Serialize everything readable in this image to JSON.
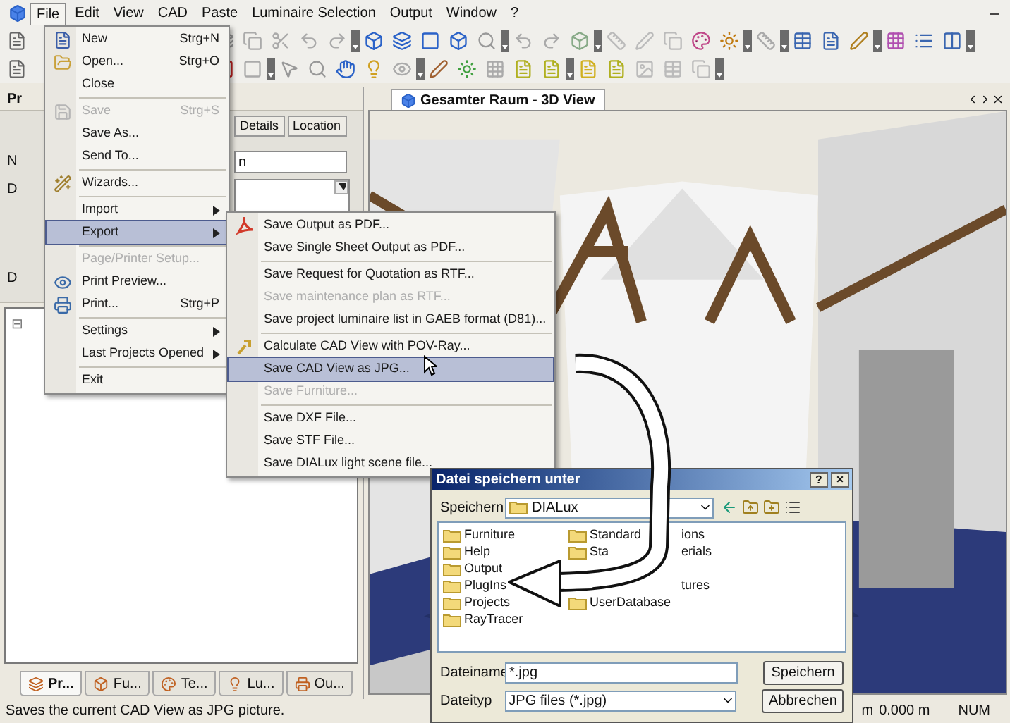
{
  "menubar": {
    "items": [
      {
        "label": "File",
        "selected": true
      },
      {
        "label": "Edit",
        "selected": false
      },
      {
        "label": "View",
        "selected": false
      },
      {
        "label": "CAD",
        "selected": false
      },
      {
        "label": "Paste",
        "selected": false
      },
      {
        "label": "Luminaire Selection",
        "selected": false
      },
      {
        "label": "Output",
        "selected": false
      },
      {
        "label": "Window",
        "selected": false
      },
      {
        "label": "?",
        "selected": false
      }
    ]
  },
  "file_menu": {
    "items": [
      {
        "kind": "item",
        "label": "New",
        "shortcut": "Strg+N",
        "submenu": false,
        "disabled": false,
        "selected": false
      },
      {
        "kind": "item",
        "label": "Open...",
        "shortcut": "Strg+O",
        "submenu": false,
        "disabled": false,
        "selected": false
      },
      {
        "kind": "item",
        "label": "Close",
        "submenu": false,
        "disabled": false,
        "selected": false
      },
      {
        "kind": "separator"
      },
      {
        "kind": "item",
        "label": "Save",
        "shortcut": "Strg+S",
        "submenu": false,
        "disabled": true,
        "selected": false
      },
      {
        "kind": "item",
        "label": "Save As...",
        "submenu": false,
        "disabled": false,
        "selected": false
      },
      {
        "kind": "item",
        "label": "Send To...",
        "submenu": false,
        "disabled": false,
        "selected": false
      },
      {
        "kind": "separator"
      },
      {
        "kind": "item",
        "label": "Wizards...",
        "submenu": false,
        "disabled": false,
        "selected": false
      },
      {
        "kind": "separator"
      },
      {
        "kind": "item",
        "label": "Import",
        "submenu": true,
        "disabled": false,
        "selected": false
      },
      {
        "kind": "item",
        "label": "Export",
        "submenu": true,
        "disabled": false,
        "selected": true
      },
      {
        "kind": "separator"
      },
      {
        "kind": "item",
        "label": "Page/Printer Setup...",
        "submenu": false,
        "disabled": true,
        "selected": false
      },
      {
        "kind": "item",
        "label": "Print Preview...",
        "submenu": false,
        "disabled": false,
        "selected": false
      },
      {
        "kind": "item",
        "label": "Print...",
        "shortcut": "Strg+P",
        "submenu": false,
        "disabled": false,
        "selected": false
      },
      {
        "kind": "separator"
      },
      {
        "kind": "item",
        "label": "Settings",
        "submenu": true,
        "disabled": false,
        "selected": false
      },
      {
        "kind": "item",
        "label": "Last Projects Opened",
        "submenu": true,
        "disabled": false,
        "selected": false
      },
      {
        "kind": "separator"
      },
      {
        "kind": "item",
        "label": "Exit",
        "submenu": false,
        "disabled": false,
        "selected": false
      }
    ]
  },
  "export_menu": {
    "items": [
      {
        "kind": "item",
        "label": "Save Output as PDF...",
        "submenu": false,
        "disabled": false,
        "selected": false
      },
      {
        "kind": "item",
        "label": "Save Single Sheet Output as PDF...",
        "submenu": false,
        "disabled": false,
        "selected": false
      },
      {
        "kind": "separator"
      },
      {
        "kind": "item",
        "label": "Save Request for Quotation as RTF...",
        "submenu": false,
        "disabled": false,
        "selected": false
      },
      {
        "kind": "item",
        "label": "Save maintenance plan as RTF...",
        "submenu": false,
        "disabled": true,
        "selected": false
      },
      {
        "kind": "item",
        "label": "Save project luminaire list in GAEB format (D81)...",
        "submenu": false,
        "disabled": false,
        "selected": false
      },
      {
        "kind": "separator"
      },
      {
        "kind": "item",
        "label": "Calculate CAD View with POV-Ray...",
        "submenu": false,
        "disabled": false,
        "selected": false
      },
      {
        "kind": "item",
        "label": "Save CAD View as JPG...",
        "submenu": false,
        "disabled": false,
        "selected": true
      },
      {
        "kind": "item",
        "label": "Save Furniture...",
        "submenu": false,
        "disabled": true,
        "selected": false
      },
      {
        "kind": "separator"
      },
      {
        "kind": "item",
        "label": "Save DXF File...",
        "submenu": false,
        "disabled": false,
        "selected": false
      },
      {
        "kind": "item",
        "label": "Save STF File...",
        "submenu": false,
        "disabled": false,
        "selected": false
      },
      {
        "kind": "item",
        "label": "Save DIALux light scene file...",
        "submenu": false,
        "disabled": false,
        "selected": false
      }
    ]
  },
  "left_panel": {
    "title": "Pr",
    "tabs": [
      {
        "label": "Details",
        "selected": false
      },
      {
        "label": "Location",
        "selected": false
      }
    ],
    "labels": [
      "N",
      "D",
      "D"
    ],
    "name_value": "n",
    "tree_toggle": "⊟",
    "bottom_tabs": [
      {
        "label": "Pr...",
        "selected": true
      },
      {
        "label": "Fu...",
        "selected": false
      },
      {
        "label": "Te...",
        "selected": false
      },
      {
        "label": "Lu...",
        "selected": false
      },
      {
        "label": "Ou...",
        "selected": false
      }
    ]
  },
  "view": {
    "tab": "Gesamter Raum - 3D View"
  },
  "dialog": {
    "title": "Datei speichern unter",
    "help": "?",
    "close": "×",
    "save_in_label": "Speichern",
    "location": "DIALux",
    "files_left": [
      "Furniture",
      "Help",
      "Output",
      "PlugIns",
      "Projects",
      "RayTracer"
    ],
    "files_right": [
      {
        "head": "Standard",
        "tail": "ions"
      },
      {
        "head": "Sta",
        "tail": "erials"
      },
      {
        "tail": "tures"
      },
      {
        "head": "UserDatabase"
      }
    ],
    "filename_label": "Dateiname",
    "filename_value": "*.jpg",
    "filetype_label": "Dateityp",
    "filetype_value": "JPG files (*.jpg)",
    "save_button": "Speichern",
    "cancel_button": "Abbrechen"
  },
  "status_bar": {
    "message": "Saves the current CAD View as JPG picture.",
    "unit": "m",
    "coordinate": "0.000 m",
    "mode": "NUM"
  }
}
